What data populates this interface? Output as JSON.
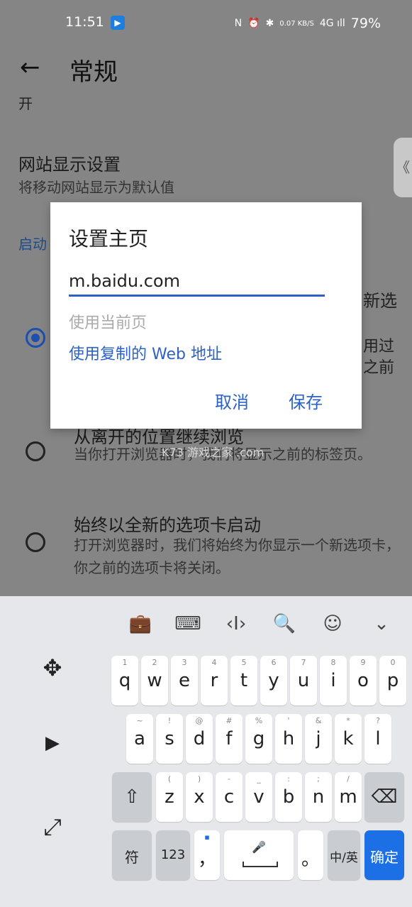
{
  "status_bar": {
    "time": "11:51",
    "app_badge": "▶",
    "icons": [
      "N",
      "⏰",
      "✱",
      "0.07 KB/S",
      "4G ıll"
    ],
    "battery": "79%"
  },
  "header": {
    "back": "←",
    "title": "常规"
  },
  "background": {
    "fragment": "开",
    "site_display_title": "网站显示设置",
    "site_display_sub": "将移动网站显示为默认值",
    "section_startup": "启动",
    "peek_right_1": "新选",
    "peek_right_2": "用过",
    "peek_right_3": "之前",
    "option_resume_title": "从离开的位置继续浏览",
    "option_resume_sub": "当你打开浏览器时，我们将显示之前的标签页。",
    "option_new_tab_title": "始终以全新的选项卡启动",
    "option_new_tab_sub": "打开浏览器时，我们将始终为你显示一个新选项卡，你之前的选项卡将关闭。",
    "side_tab": "《",
    "watermark": "K73 游戏之家 .com"
  },
  "dialog": {
    "title": "设置主页",
    "input_value": "m.baidu.com",
    "use_current_page": "使用当前页",
    "use_copied_url": "使用复制的 Web 地址",
    "cancel": "取消",
    "save": "保存"
  },
  "keyboard": {
    "toolbar": [
      "💼",
      "⌨",
      "‹I›",
      "🔍",
      "☺",
      "⌄"
    ],
    "side": [
      "✥",
      "▶",
      "⤢"
    ],
    "row1": [
      [
        "1",
        "q"
      ],
      [
        "2",
        "w"
      ],
      [
        "3",
        "e"
      ],
      [
        "4",
        "r"
      ],
      [
        "5",
        "t"
      ],
      [
        "6",
        "y"
      ],
      [
        "7",
        "u"
      ],
      [
        "8",
        "i"
      ],
      [
        "9",
        "o"
      ],
      [
        "0",
        "p"
      ]
    ],
    "row2": [
      [
        "~",
        "a"
      ],
      [
        "!",
        "s"
      ],
      [
        "@",
        "d"
      ],
      [
        "#",
        "f"
      ],
      [
        "%",
        "g"
      ],
      [
        "'",
        "h"
      ],
      [
        "&",
        "j"
      ],
      [
        "*",
        "k"
      ],
      [
        "?",
        "l"
      ]
    ],
    "row3": [
      [
        "(",
        "z"
      ],
      [
        ")",
        "x"
      ],
      [
        "-",
        "c"
      ],
      [
        "_",
        "v"
      ],
      [
        ":",
        "b"
      ],
      [
        ";",
        "n"
      ],
      [
        "/",
        "m"
      ]
    ],
    "shift": "⇧",
    "backspace": "⌫",
    "sym": "符",
    "num": "123",
    "comma": "，",
    "space_hint": "🎤",
    "period": "。",
    "lang": "中/英",
    "confirm": "确定"
  }
}
